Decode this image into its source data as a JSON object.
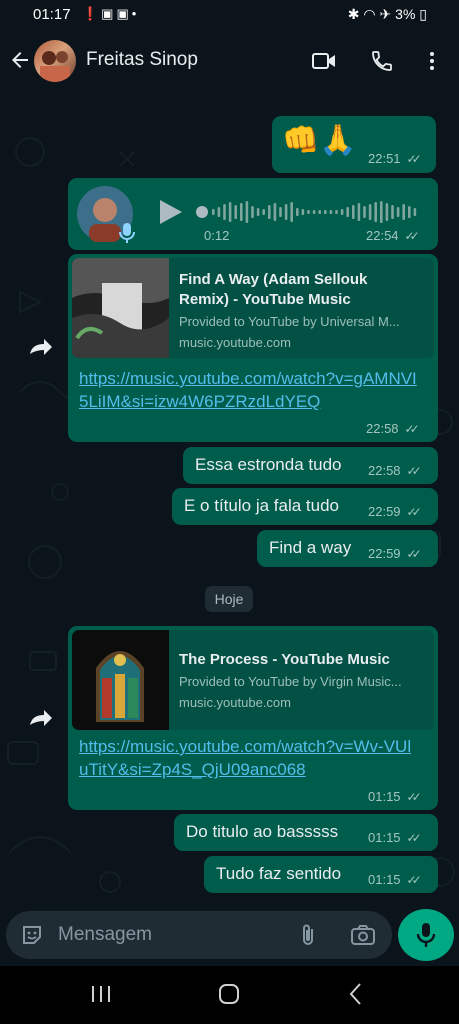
{
  "status_bar": {
    "time": "01:17",
    "battery": "3%"
  },
  "header": {
    "contact_name": "Freitas Sinop"
  },
  "messages": [
    {
      "id": "m1",
      "text": "👊🙏",
      "time": "22:51"
    },
    {
      "id": "m2",
      "type": "voice",
      "duration": "0:12",
      "time": "22:54"
    },
    {
      "id": "m3",
      "type": "link",
      "preview_title": "Find A Way (Adam Sellouk Remix) - YouTube Music",
      "preview_desc": "Provided to YouTube by Universal M...",
      "preview_domain": "music.youtube.com",
      "url": "https://music.youtube.com/watch?v=gAMNVI5LiIM&si=izw4W6PZRzdLdYEQ",
      "time": "22:58"
    },
    {
      "id": "m4",
      "text": "Essa estronda tudo",
      "time": "22:58"
    },
    {
      "id": "m5",
      "text": "E o título ja fala tudo",
      "time": "22:59"
    },
    {
      "id": "m6",
      "text": "Find a way",
      "time": "22:59"
    },
    {
      "id": "m7",
      "type": "link",
      "preview_title": "The Process - YouTube Music",
      "preview_desc": "Provided to YouTube by Virgin Music...",
      "preview_domain": "music.youtube.com",
      "url": "https://music.youtube.com/watch?v=Wv-VUluTitY&si=Zp4S_QjU09anc068",
      "time": "01:15"
    },
    {
      "id": "m8",
      "text": "Do titulo ao basssss",
      "time": "01:15"
    },
    {
      "id": "m9",
      "text": "Tudo faz sentido",
      "time": "01:15"
    }
  ],
  "day_divider": "Hoje",
  "composer": {
    "placeholder": "Mensagem"
  },
  "icons": {
    "back": "arrow-left-icon",
    "video": "video-call-icon",
    "phone": "voice-call-icon",
    "menu": "more-vert-icon",
    "sticker": "sticker-icon",
    "attach": "paperclip-icon",
    "camera": "camera-icon",
    "mic": "mic-icon",
    "play": "play-icon",
    "forward": "forward-icon"
  },
  "colors": {
    "bubble_out": "#005c4b",
    "background": "#0b141a",
    "link": "#53bdeb",
    "accent": "#00a884"
  }
}
